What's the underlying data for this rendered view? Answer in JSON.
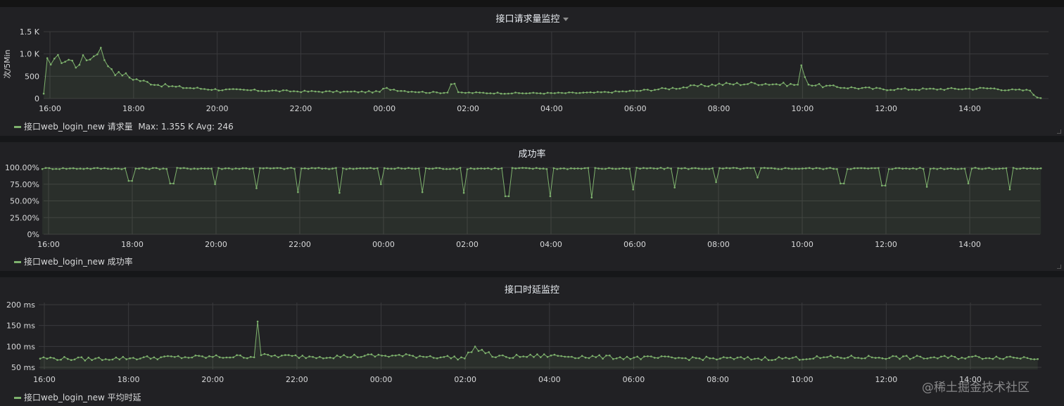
{
  "panels": [
    {
      "title": "接口请求量监控",
      "legend_text": "接口web_login_new 请求量",
      "legend_stats": "Max: 1.355 K  Avg: 246",
      "chart_data": {
        "type": "area",
        "ylabel": "次/5Min",
        "ylim": [
          0,
          1500
        ],
        "yticks": [
          "0",
          "500",
          "1.0 K",
          "1.5 K"
        ],
        "ytick_values": [
          0,
          500,
          1000,
          1500
        ],
        "xticks": [
          "16:00",
          "18:00",
          "20:00",
          "22:00",
          "00:00",
          "02:00",
          "04:00",
          "06:00",
          "08:00",
          "10:00",
          "12:00",
          "14:00"
        ],
        "x_hours": [
          15.85,
          15.7
        ],
        "keypoints": [
          [
            15.85,
            100
          ],
          [
            15.92,
            820
          ],
          [
            16.0,
            830
          ],
          [
            16.1,
            920
          ],
          [
            16.2,
            890
          ],
          [
            16.35,
            850
          ],
          [
            16.5,
            880
          ],
          [
            16.6,
            720
          ],
          [
            16.75,
            880
          ],
          [
            16.9,
            880
          ],
          [
            17.0,
            990
          ],
          [
            17.1,
            900
          ],
          [
            17.2,
            1355
          ],
          [
            17.3,
            820
          ],
          [
            17.45,
            720
          ],
          [
            17.6,
            540
          ],
          [
            17.75,
            560
          ],
          [
            17.9,
            480
          ],
          [
            18.1,
            420
          ],
          [
            18.3,
            370
          ],
          [
            18.6,
            310
          ],
          [
            19.0,
            260
          ],
          [
            19.5,
            230
          ],
          [
            20.0,
            200
          ],
          [
            21.0,
            180
          ],
          [
            22.0,
            160
          ],
          [
            23.0,
            150
          ],
          [
            23.9,
            150
          ],
          [
            24.0,
            230
          ],
          [
            24.5,
            170
          ],
          [
            25.0,
            140
          ],
          [
            25.5,
            130
          ],
          [
            25.65,
            440
          ],
          [
            25.75,
            130
          ],
          [
            26.0,
            130
          ],
          [
            27.0,
            120
          ],
          [
            28.0,
            120
          ],
          [
            29.0,
            130
          ],
          [
            30.0,
            170
          ],
          [
            31.0,
            240
          ],
          [
            32.0,
            320
          ],
          [
            33.0,
            340
          ],
          [
            33.5,
            320
          ],
          [
            33.9,
            310
          ],
          [
            34.0,
            830
          ],
          [
            34.1,
            330
          ],
          [
            34.5,
            280
          ],
          [
            35.0,
            250
          ],
          [
            36.0,
            210
          ],
          [
            37.0,
            210
          ],
          [
            38.0,
            220
          ],
          [
            38.5,
            230
          ],
          [
            39.0,
            190
          ],
          [
            39.5,
            180
          ],
          [
            39.55,
            30
          ],
          [
            39.7,
            10
          ]
        ],
        "points": 280,
        "noise": 0.12,
        "series": [
          {
            "name": "接口web_login_new 请求量"
          }
        ]
      }
    },
    {
      "title": "成功率",
      "legend_text": "接口web_login_new 成功率",
      "legend_stats": "",
      "chart_data": {
        "type": "area",
        "ylabel": "",
        "ylim": [
          0,
          100
        ],
        "yticks": [
          "0%",
          "25.00%",
          "50.00%",
          "75.00%",
          "100.00%"
        ],
        "ytick_values": [
          0,
          25,
          50,
          75,
          100
        ],
        "xticks": [
          "16:00",
          "18:00",
          "20:00",
          "22:00",
          "00:00",
          "02:00",
          "04:00",
          "06:00",
          "08:00",
          "10:00",
          "12:00",
          "14:00"
        ],
        "x_hours": [
          15.85,
          39.7
        ],
        "baseline": 98.5,
        "dips": [
          [
            17.95,
            80
          ],
          [
            18.95,
            76
          ],
          [
            19.95,
            75
          ],
          [
            20.95,
            69
          ],
          [
            21.95,
            63
          ],
          [
            22.95,
            62
          ],
          [
            23.95,
            75
          ],
          [
            24.95,
            63
          ],
          [
            25.95,
            62
          ],
          [
            26.95,
            57
          ],
          [
            27.95,
            57
          ],
          [
            28.95,
            55
          ],
          [
            29.95,
            67
          ],
          [
            30.95,
            70
          ],
          [
            31.95,
            78
          ],
          [
            32.95,
            85
          ],
          [
            33.95,
            98
          ],
          [
            34.95,
            76
          ],
          [
            35.95,
            73
          ],
          [
            36.95,
            71
          ],
          [
            37.95,
            76
          ],
          [
            38.95,
            67
          ]
        ],
        "points": 290,
        "series": [
          {
            "name": "接口web_login_new 成功率"
          }
        ]
      }
    },
    {
      "title": "接口时延监控",
      "legend_text": "接口web_login_new 平均时延",
      "legend_stats": "",
      "chart_data": {
        "type": "area",
        "ylabel": "",
        "ylim": [
          45,
          205
        ],
        "yticks": [
          "50 ms",
          "100 ms",
          "150 ms",
          "200 ms"
        ],
        "ytick_values": [
          50,
          100,
          150,
          200
        ],
        "xticks": [
          "16:00",
          "18:00",
          "20:00",
          "22:00",
          "00:00",
          "02:00",
          "04:00",
          "06:00",
          "08:00",
          "10:00",
          "12:00",
          "14:00"
        ],
        "x_hours": [
          15.9,
          39.6
        ],
        "keypoints": [
          [
            15.9,
            72
          ],
          [
            17.0,
            70
          ],
          [
            18.0,
            72
          ],
          [
            19.0,
            74
          ],
          [
            20.0,
            75
          ],
          [
            21.0,
            76
          ],
          [
            21.0,
            68
          ],
          [
            21.05,
            183
          ],
          [
            21.15,
            78
          ],
          [
            22.0,
            76
          ],
          [
            23.0,
            76
          ],
          [
            24.0,
            78
          ],
          [
            25.0,
            77
          ],
          [
            26.0,
            72
          ],
          [
            26.2,
            98
          ],
          [
            26.5,
            85
          ],
          [
            26.7,
            75
          ],
          [
            27.0,
            75
          ],
          [
            28.0,
            78
          ],
          [
            29.0,
            75
          ],
          [
            30.0,
            73
          ],
          [
            31.0,
            72
          ],
          [
            32.0,
            71
          ],
          [
            33.0,
            71
          ],
          [
            34.0,
            72
          ],
          [
            35.0,
            74
          ],
          [
            36.0,
            74
          ],
          [
            37.0,
            73
          ],
          [
            38.0,
            74
          ],
          [
            39.0,
            74
          ],
          [
            39.6,
            72
          ]
        ],
        "points": 290,
        "noise": 0.06,
        "series": [
          {
            "name": "接口web_login_new 平均时延"
          }
        ]
      }
    }
  ],
  "colors": {
    "series": "#7eb26d",
    "grid": "#3a3a3d",
    "axis_text": "#d8d9da"
  },
  "watermark": "@稀土掘金技术社区"
}
